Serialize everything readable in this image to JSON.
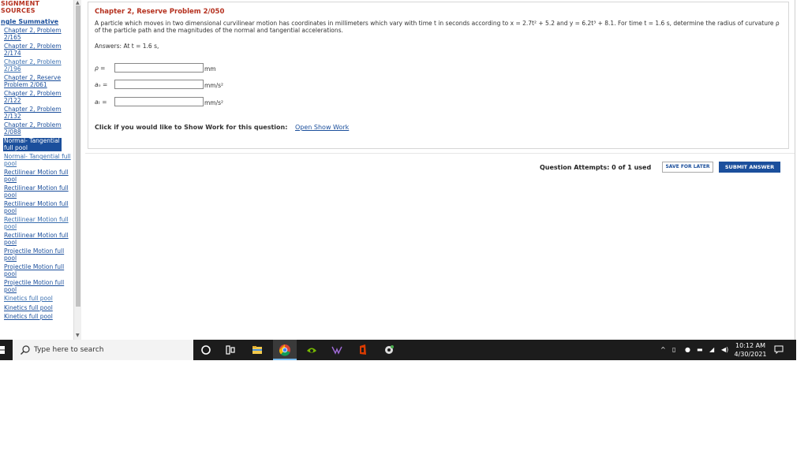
{
  "sidebar": {
    "header_line1": "SIGNMENT",
    "header_line2": "SOURCES",
    "section_title": "ngle Summative",
    "items": [
      {
        "label": "Chapter 2, Problem 2/165",
        "style": "link"
      },
      {
        "label": "Chapter 2, Problem 2/174",
        "style": "link"
      },
      {
        "label": "Chapter 2, Problem 2/196",
        "style": "plain"
      },
      {
        "label": "Chapter 2, Reserve Problem 2/061",
        "style": "link"
      },
      {
        "label": "Chapter 2, Problem 2/122",
        "style": "link"
      },
      {
        "label": "Chapter 2, Problem 2/132",
        "style": "link"
      },
      {
        "label": "Chapter 2, Problem 2/088",
        "style": "link"
      },
      {
        "label": "Normal- Tangential full pool",
        "style": "active"
      },
      {
        "label": "Normal- Tangential full pool",
        "style": "plain"
      },
      {
        "label": "Rectilinear Motion full pool",
        "style": "link"
      },
      {
        "label": "Rectilinear Motion full pool",
        "style": "link"
      },
      {
        "label": "Rectilinear Motion full pool",
        "style": "link"
      },
      {
        "label": "Rectilinear Motion full pool",
        "style": "plain"
      },
      {
        "label": "Rectilinear Motion full pool",
        "style": "link"
      },
      {
        "label": "Projectile Motion full pool",
        "style": "link"
      },
      {
        "label": "Projectile Motion full pool",
        "style": "link"
      },
      {
        "label": "Projectile Motion full pool",
        "style": "link"
      },
      {
        "label": "Kinetics full pool",
        "style": "plain"
      },
      {
        "label": "Kinetics full pool",
        "style": "link"
      },
      {
        "label": "Kinetics full pool",
        "style": "link"
      }
    ]
  },
  "question": {
    "title": "Chapter 2, Reserve Problem 2/050",
    "text": "A particle which moves in two dimensional curvilinear motion has coordinates in millimeters which vary with time t in seconds according to x = 2.7t² + 5.2 and y = 6.2t³ + 8.1. For time t = 1.6 s, determine the radius of curvature ρ of the particle path and the magnitudes of the normal and tangential accelerations.",
    "answers_intro": "Answers: At t = 1.6 s,",
    "fields": [
      {
        "label": "ρ =",
        "value": "",
        "unit": "mm"
      },
      {
        "label": "aₙ =",
        "value": "",
        "unit": "mm/s²"
      },
      {
        "label": "aₜ =",
        "value": "",
        "unit": "mm/s²"
      }
    ],
    "show_work_prompt": "Click if you would like to Show Work for this question:",
    "show_work_link": "Open Show Work"
  },
  "footer": {
    "attempts": "Question Attempts: 0 of 1 used",
    "save_label": "SAVE FOR LATER",
    "submit_label": "SUBMIT ANSWER"
  },
  "taskbar": {
    "search_placeholder": "Type here to search",
    "time": "10:12 AM",
    "date": "4/30/2021",
    "apps": [
      "cortana-icon",
      "task-view-icon",
      "file-explorer-icon",
      "chrome-icon",
      "nvidia-icon",
      "acer-icon",
      "office-icon",
      "settings-icon"
    ]
  },
  "colors": {
    "accent_red": "#b5311f",
    "link_blue": "#1b4f9c",
    "taskbar": "#1c1c1c"
  }
}
